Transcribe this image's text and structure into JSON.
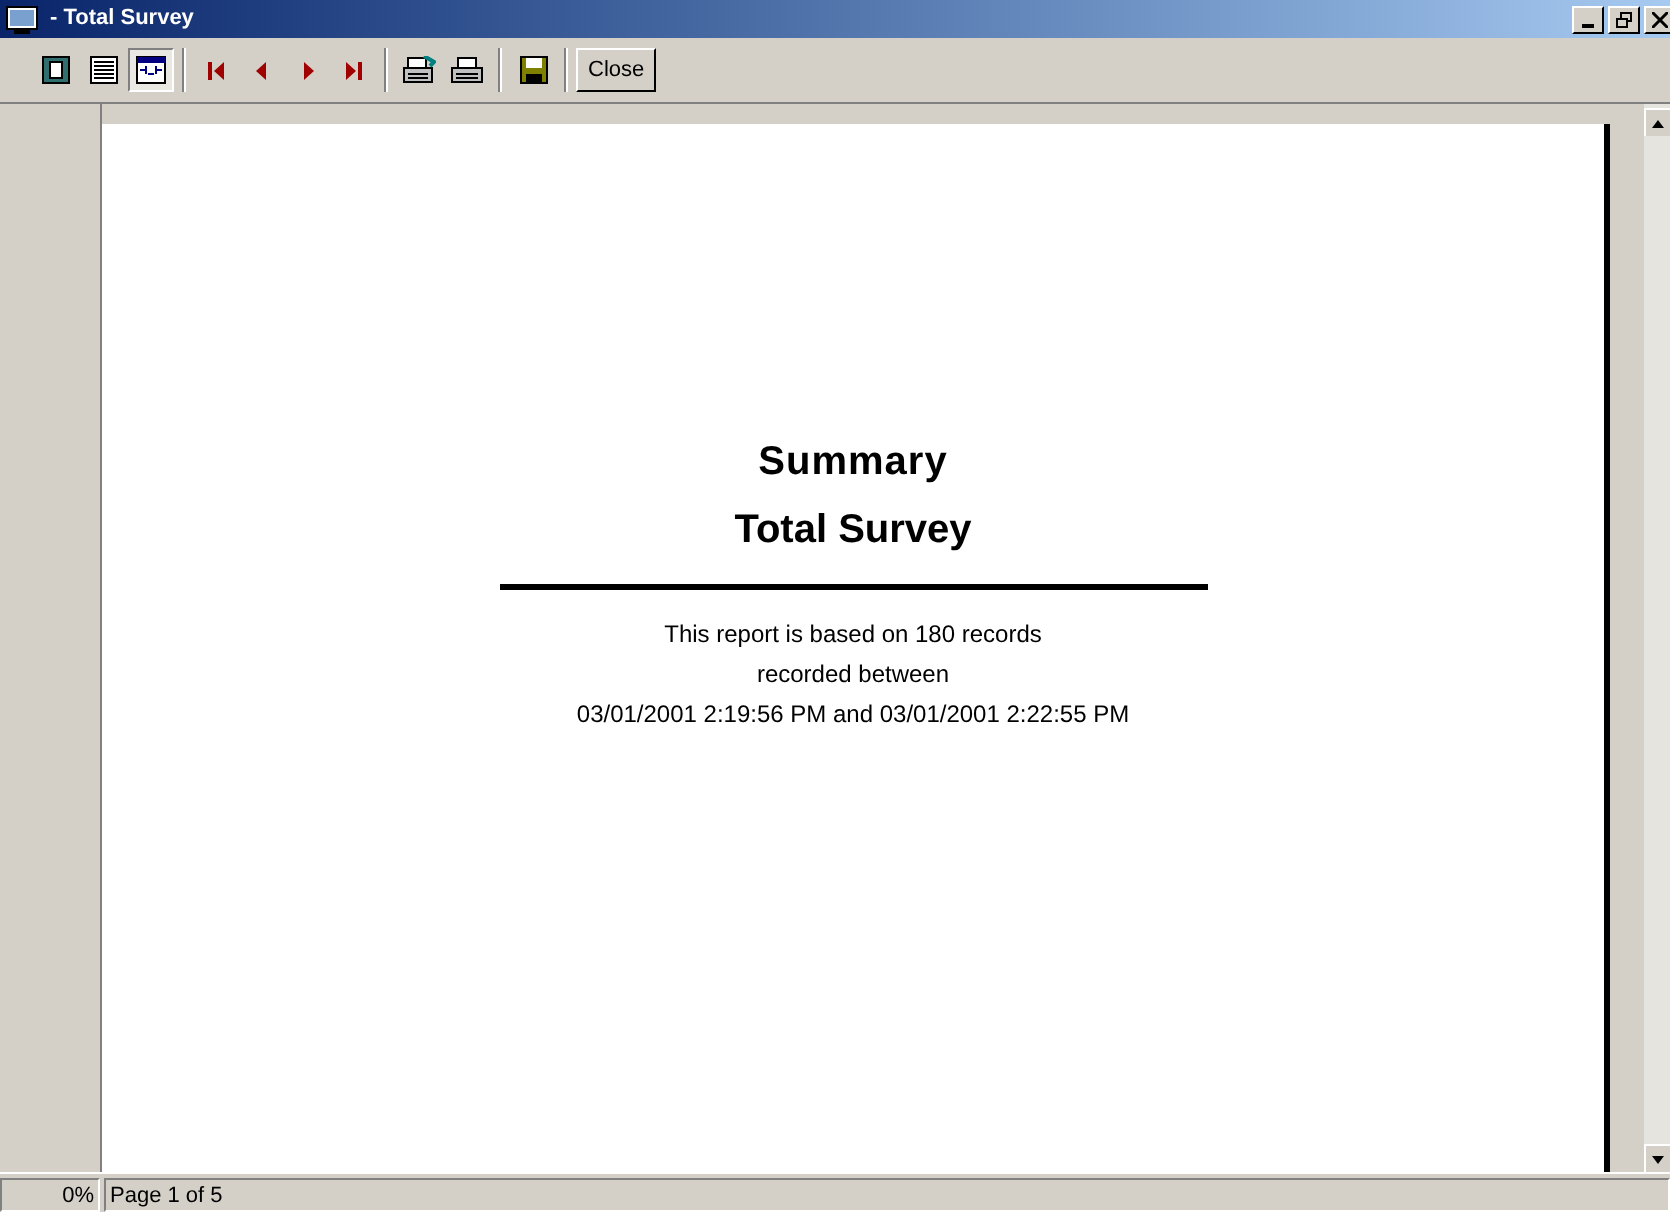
{
  "window": {
    "title": "- Total Survey"
  },
  "toolbar": {
    "view_buttons": [
      {
        "selected": false
      },
      {
        "selected": false
      },
      {
        "selected": true
      }
    ],
    "close_label": "Close"
  },
  "report": {
    "title": "Summary",
    "subtitle": "Total Survey",
    "lines": [
      "This report is based on 180 records",
      "recorded between",
      "03/01/2001 2:19:56 PM and 03/01/2001 2:22:55 PM"
    ]
  },
  "status_bar": {
    "zoom": "0%",
    "page": "Page 1 of 5"
  }
}
